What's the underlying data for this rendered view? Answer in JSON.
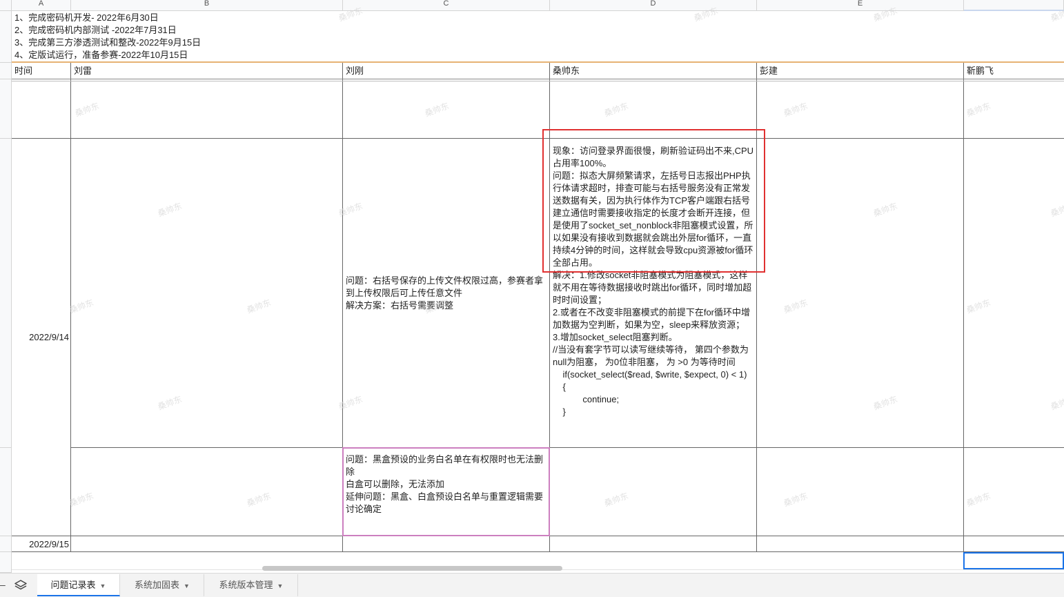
{
  "columns": [
    "A",
    "B",
    "C",
    "D",
    "E"
  ],
  "notes": [
    "1、完成密码机开发- 2022年6月30日",
    "2、完成密码机内部测试 -2022年7月31日",
    "3、完成第三方渗透测试和整改-2022年9月15日",
    "4、定版试运行，准备参赛-2022年10月15日"
  ],
  "header_row": [
    "时间",
    "刘雷",
    "刘刚",
    "桑帅东",
    "彭建",
    "靳鹏飞"
  ],
  "rows": {
    "date1": "2022/9/14",
    "date2": "2022/9/15",
    "c_issue1": "问题：右括号保存的上传文件权限过高，参赛者拿到上传权限后可上传任意文件\n解决方案：右括号需要调整",
    "d_issue1": "现象：访问登录界面很慢，刷新验证码出不来,CPU占用率100%。\n问题：拟态大屏频繁请求，左括号日志报出PHP执行体请求超时，排查可能与右括号服务没有正常发送数据有关，因为执行体作为TCP客户端跟右括号建立通信时需要接收指定的长度才会断开连接，但是使用了socket_set_nonblock非阻塞模式设置，所以如果没有接收到数据就会跳出外层for循环，一直持续4分钟的时间，这样就会导致cpu资源被for循环全部占用。\n解决：1.修改socket非阻塞模式为阻塞模式，这样就不用在等待数据接收时跳出for循环，同时增加超时时间设置；\n2.或者在不改变非阻塞模式的前提下在for循环中增加数据为空判断，如果为空，sleep来释放资源；\n3.增加socket_select阻塞判断。\n//当没有套字节可以读写继续等待， 第四个参数为null为阻塞， 为0位非阻塞， 为 >0 为等待时间\n    if(socket_select($read, $write, $expect, 0) < 1)\n    {\n            continue;\n    }",
    "c_issue2": "问题：黑盒预设的业务白名单在有权限时也无法删除\n白盒可以删除，无法添加\n延伸问题：黑盒、白盒预设白名单与重置逻辑需要讨论确定"
  },
  "watermark": "桑帅东",
  "tabs": [
    {
      "label": "问题记录表",
      "active": true
    },
    {
      "label": "系统加固表",
      "active": false
    },
    {
      "label": "系统版本管理",
      "active": false
    }
  ],
  "colors": {
    "highlight_red": "#e03030",
    "highlight_pink": "#cc7fbf",
    "header_underline": "#e6b273",
    "selection": "#1a73e8"
  }
}
